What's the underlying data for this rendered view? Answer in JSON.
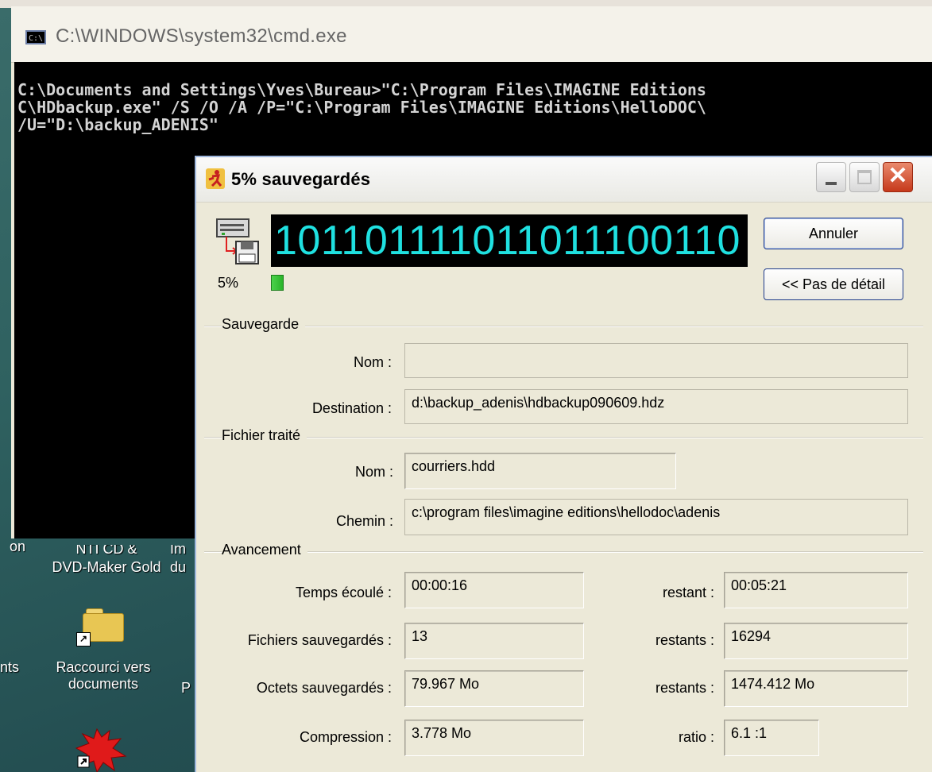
{
  "cmd": {
    "title": "C:\\WINDOWS\\system32\\cmd.exe",
    "icon_label": "C:\\",
    "lines": [
      "C:\\Documents and Settings\\Yves\\Bureau>\"C:\\Program Files\\IMAGINE Editions",
      "C\\HDbackup.exe\" /S /O /A /P=\"C:\\Program Files\\IMAGINE Editions\\HelloDOC\\",
      "/U=\"D:\\backup_ADENIS\""
    ]
  },
  "desktop": {
    "items": [
      {
        "label_line1": "NTI CD &",
        "label_line2": "DVD-Maker Gold"
      },
      {
        "label_line1": "Im",
        "label_line2": "du"
      },
      {
        "label_line1": "Raccourci vers",
        "label_line2": "documents"
      }
    ],
    "left_fragments": [
      "on",
      "nts"
    ],
    "right_fragment": "P"
  },
  "dialog": {
    "title": "5% sauvegardés",
    "binary_display": "101101111011011100110",
    "percent": "5%",
    "progress_fraction": 0.05,
    "buttons": {
      "cancel": "Annuler",
      "details": "<< Pas de détail"
    },
    "sections": {
      "sauvegarde": {
        "header": "Sauvegarde",
        "nom_label": "Nom :",
        "nom_value": "",
        "destination_label": "Destination :",
        "destination_value": "d:\\backup_adenis\\hdbackup090609.hdz"
      },
      "fichier": {
        "header": "Fichier traité",
        "nom_label": "Nom :",
        "nom_value": "courriers.hdd",
        "chemin_label": "Chemin :",
        "chemin_value": "c:\\program files\\imagine editions\\hellodoc\\adenis"
      },
      "avancement": {
        "header": "Avancement",
        "rows": [
          {
            "label": "Temps écoulé :",
            "value": "00:00:16",
            "right_label": "restant :",
            "right_value": "00:05:21"
          },
          {
            "label": "Fichiers sauvegardés :",
            "value": "13",
            "right_label": "restants :",
            "right_value": "16294"
          },
          {
            "label": "Octets sauvegardés :",
            "value": "79.967 Mo",
            "right_label": "restants :",
            "right_value": "1474.412 Mo"
          },
          {
            "label": "Compression :",
            "value": "3.778 Mo",
            "right_label": "ratio :",
            "right_value": "6.1 :1"
          }
        ]
      }
    }
  }
}
